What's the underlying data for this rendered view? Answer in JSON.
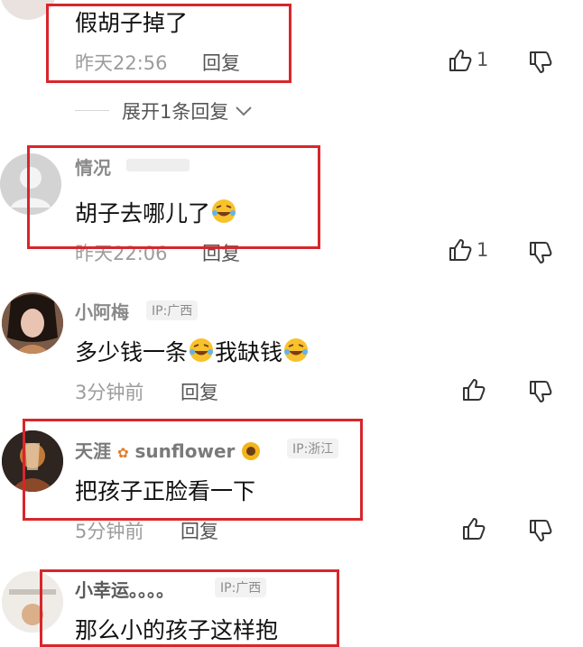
{
  "comments": [
    {
      "content": "假胡子掉了",
      "time": "昨天22:56",
      "reply_label": "回复",
      "likes": "1",
      "expand_label": "展开1条回复"
    },
    {
      "name": "情况",
      "content": "胡子去哪儿了",
      "time": "昨天22:06",
      "reply_label": "回复",
      "likes": "1"
    },
    {
      "name": "小阿梅",
      "ip": "IP:广西",
      "content_a": "多少钱一条",
      "content_b": "我缺钱",
      "time": "3分钟前",
      "reply_label": "回复"
    },
    {
      "name": "天涯",
      "name_suffix": "sunflower",
      "ip": "IP:浙江",
      "content": "把孩子正脸看一下",
      "time": "5分钟前",
      "reply_label": "回复"
    },
    {
      "name": "小幸运。。。。",
      "ip": "IP:广西",
      "content": "那么小的孩子这样抱"
    }
  ],
  "colors": {
    "highlight_box": "#d8262c",
    "meta_text": "#9c9c9c"
  }
}
